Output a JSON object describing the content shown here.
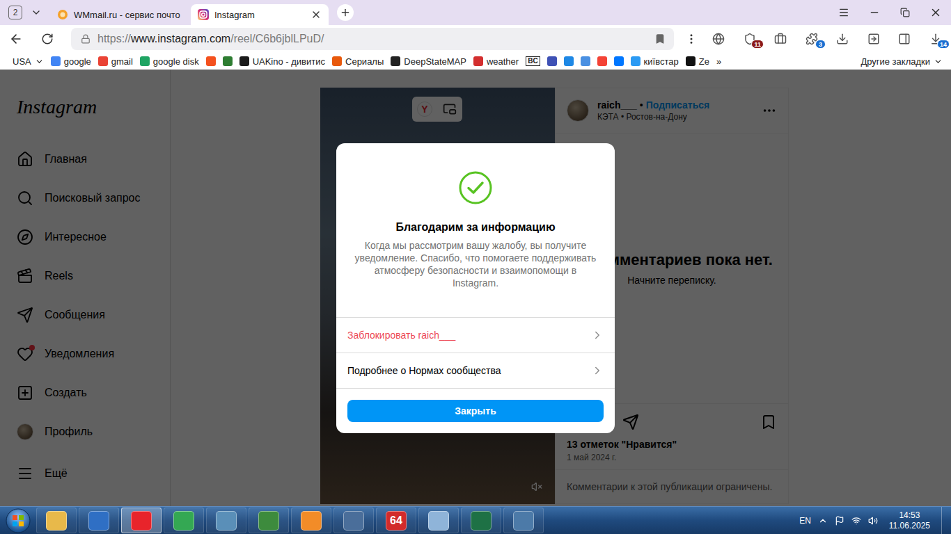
{
  "browser": {
    "tab_count": "2",
    "tabs": [
      {
        "label": "WMmail.ru - сервис почто",
        "selected": false
      },
      {
        "label": "Instagram",
        "selected": true
      }
    ],
    "address": {
      "scheme": "https://",
      "host": "www.instagram.com",
      "path": "/reel/C6b6jblLPuD/"
    },
    "extensions": [
      {},
      {
        "badge": "11",
        "color": "#8b1a1a"
      },
      {},
      {
        "badge": "3",
        "color": "#1a6fd1"
      },
      {},
      {},
      {},
      {
        "badge": "14",
        "color": "#1a6fd1"
      }
    ]
  },
  "bookmarks": [
    {
      "label": "USA",
      "kind": "menu"
    },
    {
      "label": "google",
      "kind": "link",
      "color": "#4285f4"
    },
    {
      "label": "gmail",
      "kind": "link",
      "color": "#ea4335"
    },
    {
      "label": "google disk",
      "kind": "link",
      "color": "#1fa463"
    },
    {
      "kind": "icon",
      "color": "#f4511e"
    },
    {
      "kind": "icon",
      "color": "#2e7d32"
    },
    {
      "label": "UAKino - дивитис",
      "kind": "link",
      "color": "#1a1a1a"
    },
    {
      "label": "Сериалы",
      "kind": "link",
      "color": "#e8590c"
    },
    {
      "label": "DeepStateMAP",
      "kind": "link",
      "color": "#222222"
    },
    {
      "label": "weather",
      "kind": "link",
      "color": "#d32f2f"
    },
    {
      "label": "BC",
      "kind": "badge"
    },
    {
      "kind": "icon",
      "color": "#3f51b5"
    },
    {
      "kind": "icon",
      "color": "#1e88e5"
    },
    {
      "kind": "icon",
      "color": "#4a90e2"
    },
    {
      "kind": "icon",
      "color": "#f44336"
    },
    {
      "kind": "icon",
      "color": "#0077ff"
    },
    {
      "label": "київстар",
      "kind": "link",
      "color": "#2b9af3"
    },
    {
      "label": "Ze",
      "kind": "link",
      "color": "#111111"
    },
    {
      "label": "»",
      "kind": "more"
    },
    {
      "label": "Другие закладки",
      "kind": "folder"
    }
  ],
  "sidebar": {
    "logo": "Instagram",
    "items": [
      {
        "label": "Главная",
        "kind": "icon",
        "selected": false,
        "dot": false
      },
      {
        "label": "Поисковый запрос",
        "kind": "icon",
        "selected": false,
        "dot": false
      },
      {
        "label": "Интересное",
        "kind": "icon",
        "selected": false,
        "dot": false
      },
      {
        "label": "Reels",
        "kind": "icon",
        "selected": false,
        "dot": false
      },
      {
        "label": "Сообщения",
        "kind": "icon",
        "selected": false,
        "dot": false
      },
      {
        "label": "Уведомления",
        "kind": "icon",
        "selected": false,
        "dot": true
      },
      {
        "label": "Создать",
        "kind": "icon",
        "selected": false,
        "dot": false
      },
      {
        "label": "Профиль",
        "kind": "avatar",
        "selected": false,
        "dot": false
      },
      {
        "label": "Ещё",
        "kind": "icon",
        "selected": false,
        "dot": false
      }
    ]
  },
  "post": {
    "author": "raich___",
    "separator": "•",
    "follow": "Подписаться",
    "subtitle": "КЭТА • Ростов-на-Дону",
    "video_badge": "Y",
    "muted": true,
    "empty_title": "мментариев пока нет.",
    "empty_hint": "Начните переписку.",
    "liked": false,
    "saved": false,
    "likes": "13 отметок \"Нравится\"",
    "date": "1 май 2024 г.",
    "comments_note": "Комментарии к этой публикации ограничены."
  },
  "modal": {
    "title": "Благодарим за информацию",
    "message": "Когда мы рассмотрим вашу жалобу, вы получите уведомление. Спасибо, что помогаете поддерживать атмосферу безопасности и взаимопомощи в Instagram.",
    "options": [
      {
        "label": "Заблокировать raich___",
        "kind": "danger"
      },
      {
        "label": "Подробнее о Нормах сообщества",
        "kind": "normal"
      }
    ],
    "button": "Закрыть"
  },
  "taskbar": {
    "apps": [
      {
        "color": "#e8b94a",
        "selected": false
      },
      {
        "color": "#2f6fc4",
        "selected": false
      },
      {
        "color": "#e8242b",
        "selected": true
      },
      {
        "color": "#34a853",
        "selected": false
      },
      {
        "color": "#5a8fb8",
        "selected": false
      },
      {
        "color": "#3d8b3d",
        "selected": false
      },
      {
        "color": "#f28c28",
        "selected": false
      },
      {
        "color": "#4a6e9a",
        "selected": false
      },
      {
        "label": "64",
        "color": "#d22b2b",
        "selected": false
      },
      {
        "color": "#8fb4d9",
        "selected": false
      },
      {
        "color": "#1e7145",
        "selected": false
      },
      {
        "color": "#4c7aa8",
        "selected": false
      }
    ],
    "language": "EN",
    "time": "14:53",
    "date": "11.06.2025"
  }
}
